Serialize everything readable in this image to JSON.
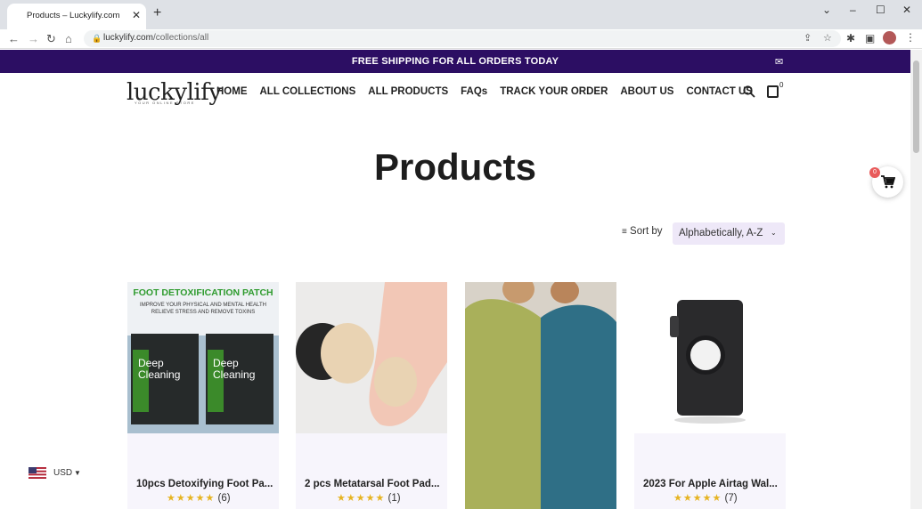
{
  "browser": {
    "tab_title": "Products – Luckylify.com",
    "url_domain": "luckylify.com",
    "url_path": "/collections/all"
  },
  "announcement": {
    "text": "FREE SHIPPING FOR ALL ORDERS TODAY"
  },
  "header": {
    "logo": "luckylify",
    "logo_tagline": "YOUR ONLINE STORE",
    "nav": [
      "HOME",
      "ALL COLLECTIONS",
      "ALL PRODUCTS",
      "FAQs",
      "TRACK YOUR ORDER",
      "ABOUT US",
      "CONTACT US"
    ],
    "cart_count": "0"
  },
  "page": {
    "title": "Products",
    "sort_label": "Sort by",
    "sort_value": "Alphabetically, A-Z",
    "floating_cart_count": "0"
  },
  "products": [
    {
      "title": "10pcs Detoxifying Foot Pa...",
      "stars": "★★★★★",
      "count": "(6)",
      "img_heading": "FOOT DETOXIFICATION PATCH",
      "img_sub1": "IMPROVE YOUR PHYSICAL AND MENTAL HEALTH",
      "img_sub2": "RELIEVE STRESS AND REMOVE TOXINS",
      "img_pack1": "Deep",
      "img_pack2": "Cleaning"
    },
    {
      "title": "2 pcs Metatarsal Foot Pad...",
      "stars": "★★★★★",
      "count": "(1)"
    },
    {
      "title": "",
      "stars": "",
      "count": ""
    },
    {
      "title": "2023 For Apple Airtag Wal...",
      "stars": "★★★★★",
      "count": "(7)"
    }
  ],
  "currency": {
    "code": "USD"
  },
  "colors": {
    "announcement_bg": "#2c0e63",
    "accent_light": "#eee8f8",
    "star": "#e6b422",
    "badge": "#e85a5a"
  }
}
